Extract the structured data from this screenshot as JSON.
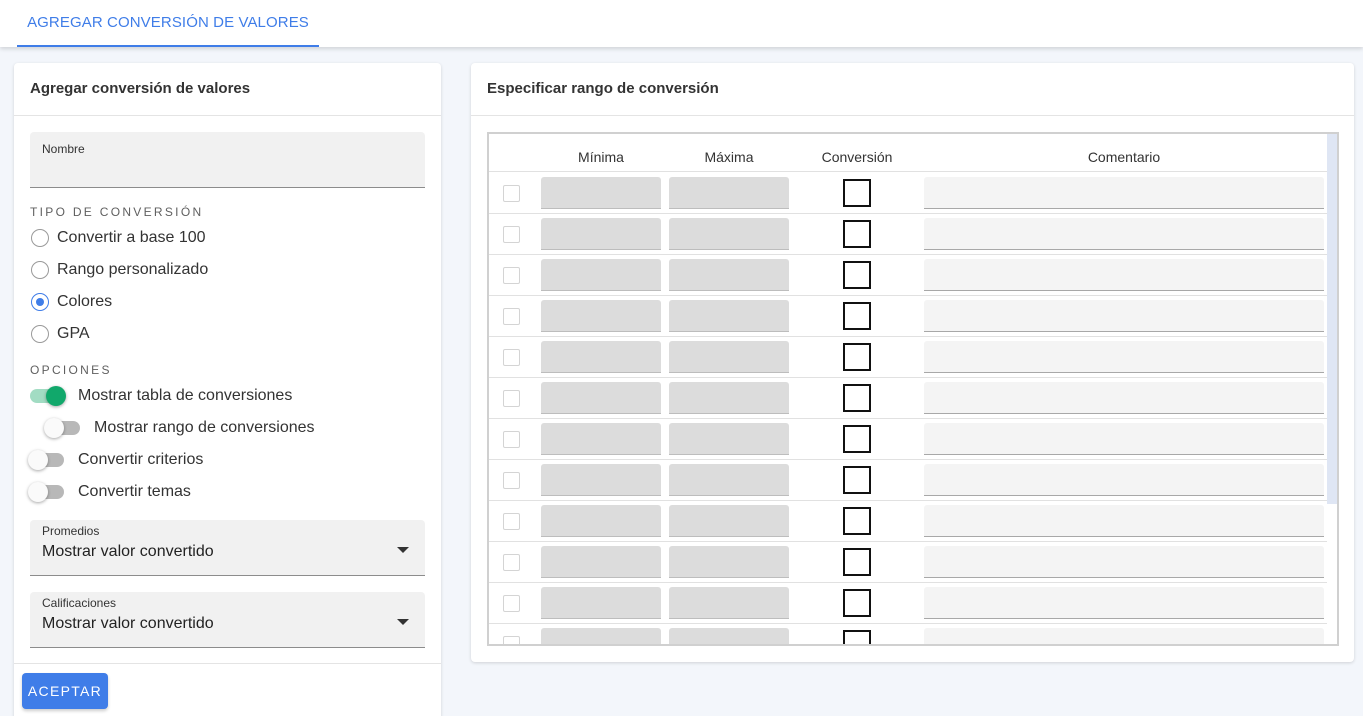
{
  "tabs": [
    {
      "label": "AGREGAR CONVERSIÓN DE VALORES",
      "active": true
    }
  ],
  "left_panel": {
    "title": "Agregar conversión de valores",
    "name_field": {
      "label": "Nombre",
      "value": ""
    },
    "conversion_type": {
      "label": "TIPO DE CONVERSIÓN",
      "options": [
        {
          "label": "Convertir a base 100",
          "selected": false
        },
        {
          "label": "Rango personalizado",
          "selected": false
        },
        {
          "label": "Colores",
          "selected": true
        },
        {
          "label": "GPA",
          "selected": false
        }
      ]
    },
    "options": {
      "label": "OPCIONES",
      "toggles": [
        {
          "label": "Mostrar tabla de conversiones",
          "on": true
        },
        {
          "label": "Mostrar rango de conversiones",
          "on": false
        },
        {
          "label": "Convertir criterios",
          "on": false
        },
        {
          "label": "Convertir temas",
          "on": false
        }
      ]
    },
    "averages_select": {
      "label": "Promedios",
      "value": "Mostrar valor convertido"
    },
    "grades_select": {
      "label": "Calificaciones",
      "value": "Mostrar valor convertido"
    },
    "accept_label": "ACEPTAR"
  },
  "right_panel": {
    "title": "Especificar rango de conversión",
    "table": {
      "columns": [
        "Mínima",
        "Máxima",
        "Conversión",
        "Comentario"
      ],
      "row_count": 12
    }
  },
  "colors": {
    "accent": "#3f7de8",
    "toggle_on": "#11a86b"
  }
}
